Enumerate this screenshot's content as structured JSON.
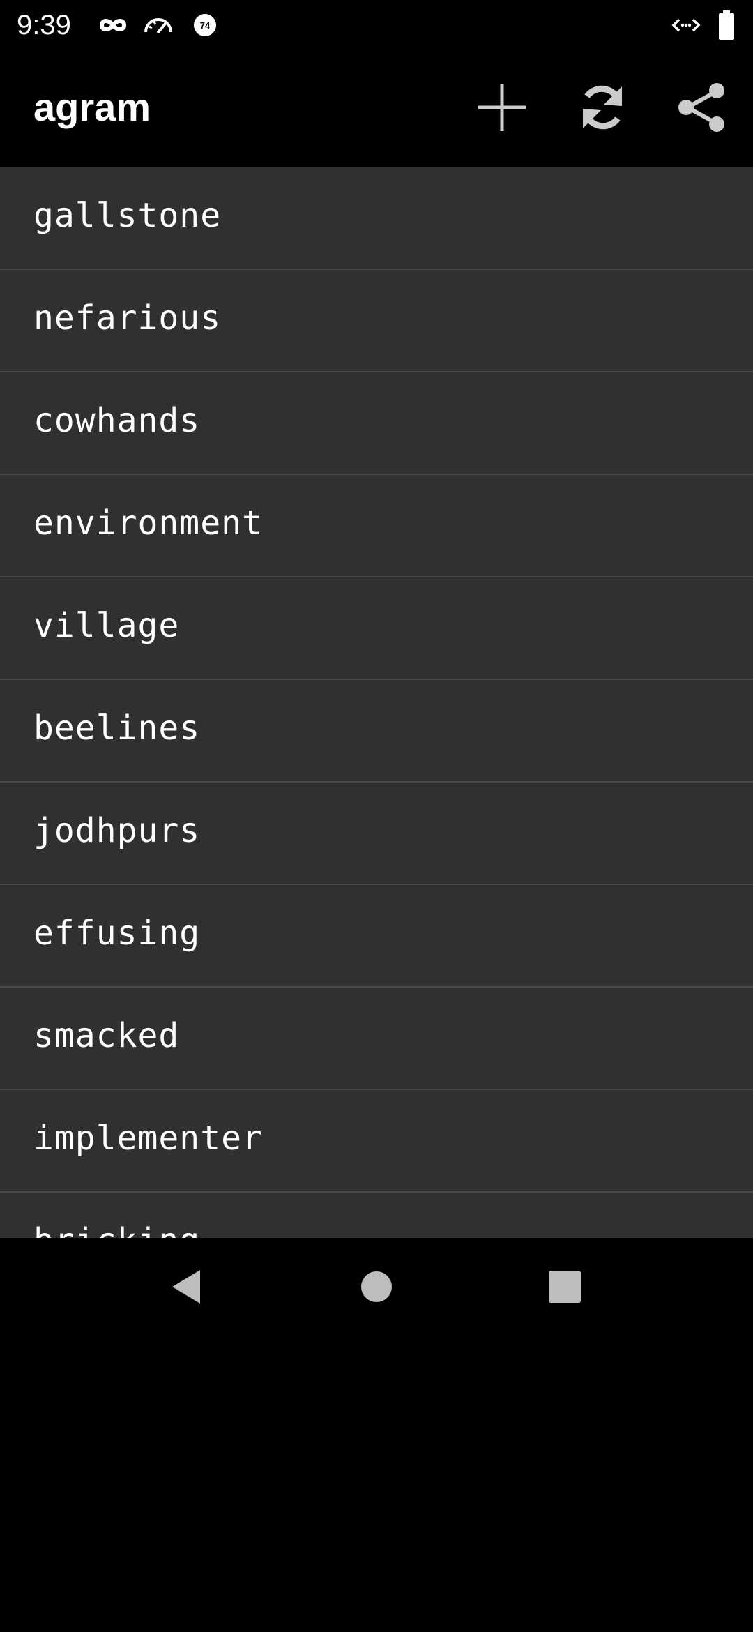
{
  "status_bar": {
    "time": "9:39",
    "battery_level_badge": "74",
    "left_icons": [
      "infinity-icon",
      "speedometer-icon",
      "battery-saver-badge-icon"
    ],
    "right_icons": [
      "data-activity-icon",
      "battery-icon"
    ]
  },
  "app_bar": {
    "title": "agram",
    "actions": [
      {
        "name": "add",
        "icon": "plus-icon"
      },
      {
        "name": "refresh",
        "icon": "refresh-icon"
      },
      {
        "name": "share",
        "icon": "share-icon"
      }
    ]
  },
  "word_list": {
    "items": [
      "gallstone",
      "nefarious",
      "cowhands",
      "environment",
      "village",
      "beelines",
      "jodhpurs",
      "effusing",
      "smacked",
      "implementer",
      "bricking"
    ]
  },
  "nav_bar": {
    "buttons": [
      "back-icon",
      "home-icon",
      "recents-icon"
    ]
  },
  "colors": {
    "background": "#000000",
    "list_background": "#303030",
    "divider": "#4a4a4a",
    "text": "#ffffff",
    "icon": "#cccccc",
    "nav_icon": "#bdbdbd"
  }
}
